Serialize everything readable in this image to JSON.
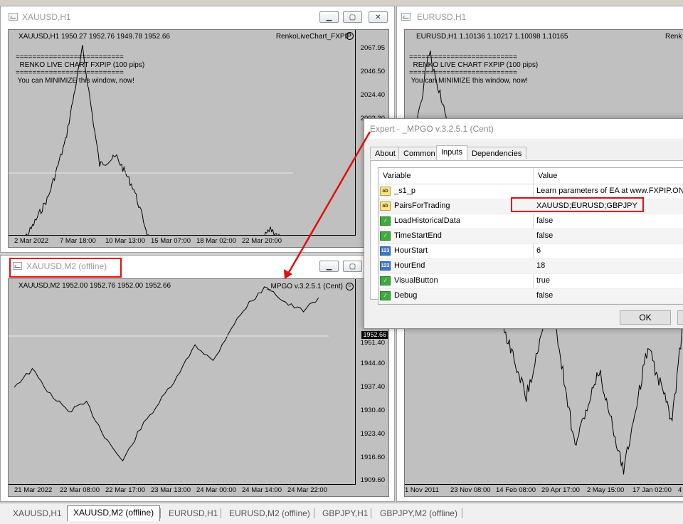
{
  "windows": {
    "xauusd_h1": {
      "title": "XAUUSD,H1",
      "info": "XAUUSD,H1  1950.27 1952.76 1949.78 1952.66",
      "indicator": "RenkoLiveChart_FXPIP",
      "renko_text": "==========================\n  RENKO LIVE CHART FXPIP (100 pips)\n==========================\n You can MINIMIZE this window, now!",
      "y_ticks": [
        "2067.95",
        "2046.50",
        "2024.40",
        "2002.30"
      ],
      "y_partial": "1",
      "x_ticks": [
        "2 Mar 2022",
        "7 Mar 18:00",
        "10 Mar 13:00",
        "15 Mar 07:00",
        "18 Mar 02:00",
        "22 Mar 20:00"
      ]
    },
    "xauusd_m2": {
      "title": "XAUUSD,M2 (offline)",
      "info": "XAUUSD,M2  1952.00 1952.76 1952.00 1952.66",
      "indicator": "_MPGO v.3.2.5.1 (Cent)",
      "price_box": "1952.66",
      "y_ticks": [
        "1951.40",
        "1944.40",
        "1937.40",
        "1930.40",
        "1923.40",
        "1916.60",
        "1909.60"
      ],
      "x_ticks": [
        "21 Mar 2022",
        "22 Mar 08:00",
        "22 Mar 17:00",
        "23 Mar 13:00",
        "24 Mar 00:00",
        "24 Mar 14:00",
        "24 Mar 22:00"
      ]
    },
    "eurusd_h1": {
      "title": "EURUSD,H1",
      "info": "EURUSD,H1  1.10136 1.10217 1.10098 1.10165",
      "indicator": "Renk",
      "renko_text": "==========================\n  RENKO LIVE CHART FXPIP (100 pips)\n==========================\n You can MINIMIZE this window, now!",
      "x_ticks": [
        "1 Nov 2011",
        "23 Nov 08:00",
        "14 Feb 08:00",
        "29 Apr 17:00",
        "2 May 15:00",
        "17 Jan 02:00",
        "4"
      ]
    }
  },
  "window_buttons": {
    "minimize": "▁",
    "maximize": "▢",
    "close": "✕"
  },
  "dialog": {
    "title": "Expert - _MPGO v.3.2.5.1 (Cent)",
    "tabs": [
      "About",
      "Common",
      "Inputs",
      "Dependencies"
    ],
    "active_tab": "Inputs",
    "columns": [
      "Variable",
      "Value"
    ],
    "rows": [
      {
        "icon": "ab",
        "name": "_s1_p",
        "value": "Learn parameters of EA at www.FXPIP.ON..."
      },
      {
        "icon": "ab",
        "name": "PairsForTrading",
        "value": "XAUUSD;EURUSD;GBPJPY"
      },
      {
        "icon": "bool",
        "name": "LoadHistoricalData",
        "value": "false"
      },
      {
        "icon": "bool",
        "name": "TimeStartEnd",
        "value": "false"
      },
      {
        "icon": "123",
        "name": "HourStart",
        "value": "6"
      },
      {
        "icon": "123",
        "name": "HourEnd",
        "value": "18"
      },
      {
        "icon": "bool",
        "name": "VisualButton",
        "value": "true"
      },
      {
        "icon": "bool",
        "name": "Debug",
        "value": "false"
      }
    ],
    "ok_label": "OK"
  },
  "tabbar": {
    "tabs": [
      "XAUUSD,H1",
      "XAUUSD,M2 (offline)",
      "EURUSD,H1",
      "EURUSD,M2 (offline)",
      "GBPJPY,H1",
      "GBPJPY,M2 (offline)"
    ],
    "active": "XAUUSD,M2 (offline)"
  },
  "colors": {
    "highlight": "#e01010",
    "chart_bg": "#c0c0c0"
  },
  "chart_data": [
    {
      "type": "line",
      "title": "XAUUSD,H1",
      "ylim": [
        1960,
        2075
      ],
      "x": [
        "2 Mar 2022",
        "7 Mar 18:00",
        "10 Mar 13:00",
        "15 Mar 07:00",
        "18 Mar 02:00",
        "22 Mar 20:00"
      ],
      "series": [
        {
          "values": [
            1940,
            1955,
            1975,
            2010,
            2068,
            1995,
            2000,
            1980,
            1945,
            1925,
            1915,
            1930,
            1920,
            1925,
            1940,
            1955,
            1945
          ]
        }
      ]
    },
    {
      "type": "line",
      "title": "XAUUSD,M2 (offline)",
      "ylim": [
        1909.6,
        1954
      ],
      "x": [
        "21 Mar 2022",
        "22 Mar 08:00",
        "22 Mar 17:00",
        "23 Mar 13:00",
        "24 Mar 00:00",
        "24 Mar 14:00",
        "24 Mar 22:00"
      ],
      "series": [
        {
          "values": [
            1930,
            1934,
            1928,
            1924,
            1926,
            1918,
            1912,
            1920,
            1926,
            1932,
            1940,
            1936,
            1944,
            1950,
            1954,
            1950,
            1948,
            1952
          ]
        }
      ]
    },
    {
      "type": "line",
      "title": "EURUSD,H1",
      "x": [
        "1 Nov 2011",
        "23 Nov 08:00",
        "14 Feb 08:00",
        "29 Apr 17:00",
        "2 May 15:00",
        "17 Jan 02:00",
        "4"
      ],
      "series": [
        {
          "values": [
            0.6,
            0.9,
            0.7,
            0.5,
            0.35,
            0.2,
            0.4,
            0.1,
            0.25,
            0.05,
            0.3,
            0.15,
            0.6
          ]
        }
      ]
    }
  ]
}
